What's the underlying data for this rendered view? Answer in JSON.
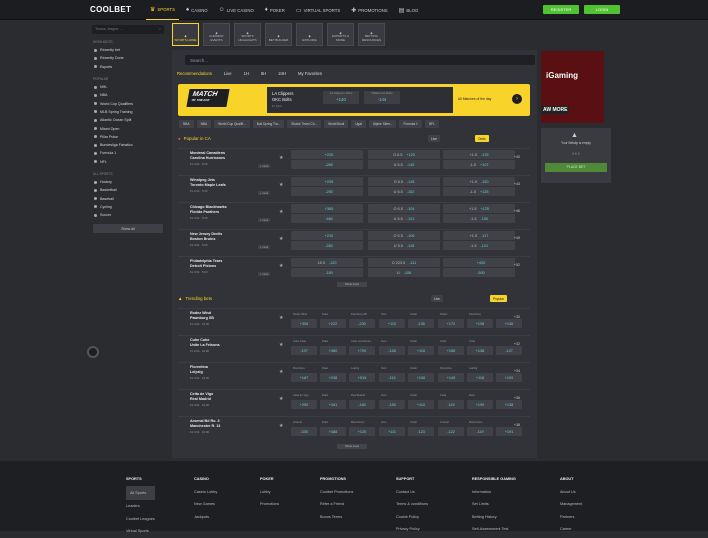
{
  "brand": {
    "logo": "COOLBET"
  },
  "nav": [
    {
      "label": "SPORTS",
      "icon": "trophy-icon",
      "active": true
    },
    {
      "label": "CASINO",
      "icon": "spade-icon"
    },
    {
      "label": "LIVE CASINO",
      "icon": "person-icon"
    },
    {
      "label": "POKER",
      "icon": "cards-icon"
    },
    {
      "label": "VIRTUAL SPORTS",
      "icon": "screen-icon"
    },
    {
      "label": "PROMOTIONS",
      "icon": "gift-icon",
      "badge": "8"
    },
    {
      "label": "BLOG",
      "icon": "news-icon"
    }
  ],
  "header": {
    "register": "REGISTER",
    "login": "LOGIN"
  },
  "sidebar": {
    "search": "Teams, league, ...",
    "highlights_h": "Highlights",
    "highlights": [
      "Recently bet",
      "Recently Done",
      "Esports"
    ],
    "popular_h": "Popular",
    "popular": [
      "NHL",
      "NBA",
      "World Cup Qualifiers",
      "MLB Spring Training",
      "Atlantic Ocean Split",
      "Miami Open",
      "Pillar Pulse",
      "Bundesliga Fanatico",
      "Formula 1",
      "NFL"
    ],
    "all_h": "All sports",
    "sports": [
      "Hockey",
      "Basketball",
      "Baseball",
      "Cycling",
      "Soccer"
    ],
    "cta": "Show all"
  },
  "cats": [
    {
      "label": "SPORTS HOME",
      "active": true
    },
    {
      "label": "CURRENT EVENTS"
    },
    {
      "label": "SPORTS HIGHLIGHTS"
    },
    {
      "label": "BET BUILDER"
    },
    {
      "label": "EXPLORE"
    },
    {
      "label": "ESPORTS & MORE"
    },
    {
      "label": "BETTING RESOURCES"
    }
  ],
  "main": {
    "search": "Search...",
    "rec_title": "Recommendations",
    "rec_tabs": [
      "Live",
      "1H",
      "6H",
      "24H",
      "My Favorites"
    ]
  },
  "motd": {
    "label": "MATCH",
    "sub": "OF THE DAY",
    "team1": "LA Clippers",
    "team2": "OKC Bolts",
    "time": "Fr 7pm",
    "o1_label": "LA Clippers Wins",
    "o1": "+140",
    "o2_label": "Oklahoma Bolts",
    "o2": "-144",
    "link": "All Matches of the day"
  },
  "chips": [
    "NBA",
    "NBA",
    "World Cup Qualifi...",
    "Bull Spring Tra...",
    "Shabs' Team Ch...",
    "World Bowl",
    "Ugat",
    "Alpine Skier...",
    "Formula 1",
    "NFL"
  ],
  "popular": {
    "title": "Popular in CA",
    "toggle": "Live",
    "filter": "Odds",
    "rows": [
      {
        "t1": "Montreal Canadiens",
        "t2": "Carolina Hurricanes",
        "info": "Fri 3/14 · 5:00",
        "o": [
          [
            "",
            "+220"
          ],
          [
            "",
            "-265"
          ],
          [
            "O 6.5",
            "+120"
          ],
          [
            "U 6.5",
            "-145"
          ],
          [
            "+1.5",
            "-125"
          ],
          [
            "-1.5",
            "+107"
          ]
        ]
      },
      {
        "t1": "Winnipeg Jets",
        "t2": "Toronto Maple Leafs",
        "info": "Fri 3/14 · 5:30",
        "o": [
          [
            "",
            "+205"
          ],
          [
            "",
            "-250"
          ],
          [
            "O 6.5",
            "-118"
          ],
          [
            "U 6.5",
            "-102"
          ],
          [
            "+1.5",
            "-150"
          ],
          [
            "-1.5",
            "+125"
          ]
        ]
      },
      {
        "t1": "Chicago Blackhawks",
        "t2": "Florida Panthers",
        "info": "Fri 3/14 · 5:30",
        "o": [
          [
            "",
            "+365"
          ],
          [
            "",
            "-460"
          ],
          [
            "O 6.5",
            "-104"
          ],
          [
            "U 6.5",
            "-121"
          ],
          [
            "+1.5",
            "+125"
          ],
          [
            "-1.5",
            "-150"
          ]
        ]
      },
      {
        "t1": "New Jersey Devils",
        "t2": "Boston Bruins",
        "info": "Fri 3/14 · 5:00",
        "o": [
          [
            "",
            "+210"
          ],
          [
            "",
            "-260"
          ],
          [
            "O 5.5",
            "-106"
          ],
          [
            "U 5.5",
            "-118"
          ],
          [
            "+1.5",
            "-117"
          ],
          [
            "-1.5",
            "-101"
          ]
        ]
      },
      {
        "t1": "Philadelphia Tears",
        "t2": "Detroit Pistons",
        "info": "Fri 3/14 · 5:00",
        "o": [
          [
            "18.5",
            "-120"
          ],
          [
            "",
            "-150"
          ],
          [
            "O 223.5",
            "-111"
          ],
          [
            "U",
            "-108"
          ],
          [
            "",
            "+400"
          ],
          [
            "",
            "-500"
          ]
        ]
      }
    ],
    "more": "Show more"
  },
  "trending": {
    "title": "Trending bets",
    "toggle": "Live",
    "filter": "Popular",
    "rows": [
      {
        "t1": "Rodez Wind",
        "t2": "Pawnburg SB",
        "info": "Fri 3/14 · 10:00",
        "lbls": [
          "Rodez Wind",
          "Draw",
          "Pawnburg SB",
          "Over",
          "Under",
          "Rodez",
          "Pawnburg"
        ],
        "o": [
          "+306",
          "+222",
          "-230",
          "+110",
          "-138",
          "+172",
          "+198",
          "+136"
        ]
      },
      {
        "t1": "Cube Cube",
        "t2": "Unite La Felsona",
        "info": "Fri 3/14 · 10:00",
        "lbls": [
          "Cube Cube",
          "Draw",
          "Unite La Felsona",
          "Over",
          "Under",
          "Cube",
          "Unite"
        ],
        "o": [
          "-197",
          "+380",
          "+790",
          "-128",
          "+116",
          "+186",
          "+138",
          "-127"
        ]
      },
      {
        "t1": "Florentina",
        "t2": "Leipzig",
        "info": "Fri 3/14 · 10:00",
        "lbls": [
          "Florentina",
          "Draw",
          "Leipzig",
          "Over",
          "Under",
          "Florentina",
          "Leipzig"
        ],
        "o": [
          "+187",
          "+238",
          "+515",
          "-115",
          "+106",
          "+145",
          "+118",
          "+109"
        ]
      },
      {
        "t1": "Celta de Vigo",
        "t2": "Real Madrid",
        "info": "Fri 3/14 · 10:00",
        "lbls": [
          "Celta de Vigo",
          "Draw",
          "Real Madrid",
          "Over",
          "Under",
          "Celta",
          "Real"
        ],
        "o": [
          "+250",
          "+341",
          "-160",
          "-155",
          "+110",
          "-115",
          "+190",
          "+138"
        ]
      },
      {
        "t1": "Arsenal Bd Ro. 3",
        "t2": "Manchester R. 13",
        "info": "Fri 3/14 · 10:00",
        "lbls": [
          "Arsenal",
          "Draw",
          "Manchester",
          "Over",
          "Under",
          "Arsenal",
          "Manchester"
        ],
        "o": [
          "-335",
          "+388",
          "+120",
          "+111",
          "-123",
          "-122",
          "-119",
          "+191"
        ]
      }
    ],
    "more": "Show more"
  },
  "banner": {
    "brand": "iGaming",
    "tag": "AW MORE"
  },
  "betslip": {
    "title": "Your Betslip is empty",
    "button": "PLACE BET"
  },
  "footer": [
    {
      "h": "SPORTS",
      "items": [
        "All Sports",
        "Leaders",
        "Coolbet Leagues",
        "Virtual Sports"
      ]
    },
    {
      "h": "CASINO",
      "items": [
        "Casino Lobby",
        "New Games",
        "Jackpots"
      ]
    },
    {
      "h": "POKER",
      "items": [
        "Lobby",
        "Promotions"
      ]
    },
    {
      "h": "PROMOTIONS",
      "items": [
        "Coolbet Promotions",
        "Refer a Friend",
        "Bonus Terms"
      ]
    },
    {
      "h": "SUPPORT",
      "items": [
        "Contact Us",
        "Terms & conditions",
        "Cookie Policy",
        "Privacy Policy"
      ]
    },
    {
      "h": "RESPONSIBLE GAMING",
      "items": [
        "Information",
        "Set Limits",
        "Betting History",
        "Self-Assessment Test"
      ]
    },
    {
      "h": "ABOUT",
      "items": [
        "About Us",
        "Management",
        "Partners",
        "Career"
      ]
    }
  ],
  "colors": {
    "accent": "#f8d32a",
    "odds": "#5fd0d8",
    "green": "#51c232"
  }
}
